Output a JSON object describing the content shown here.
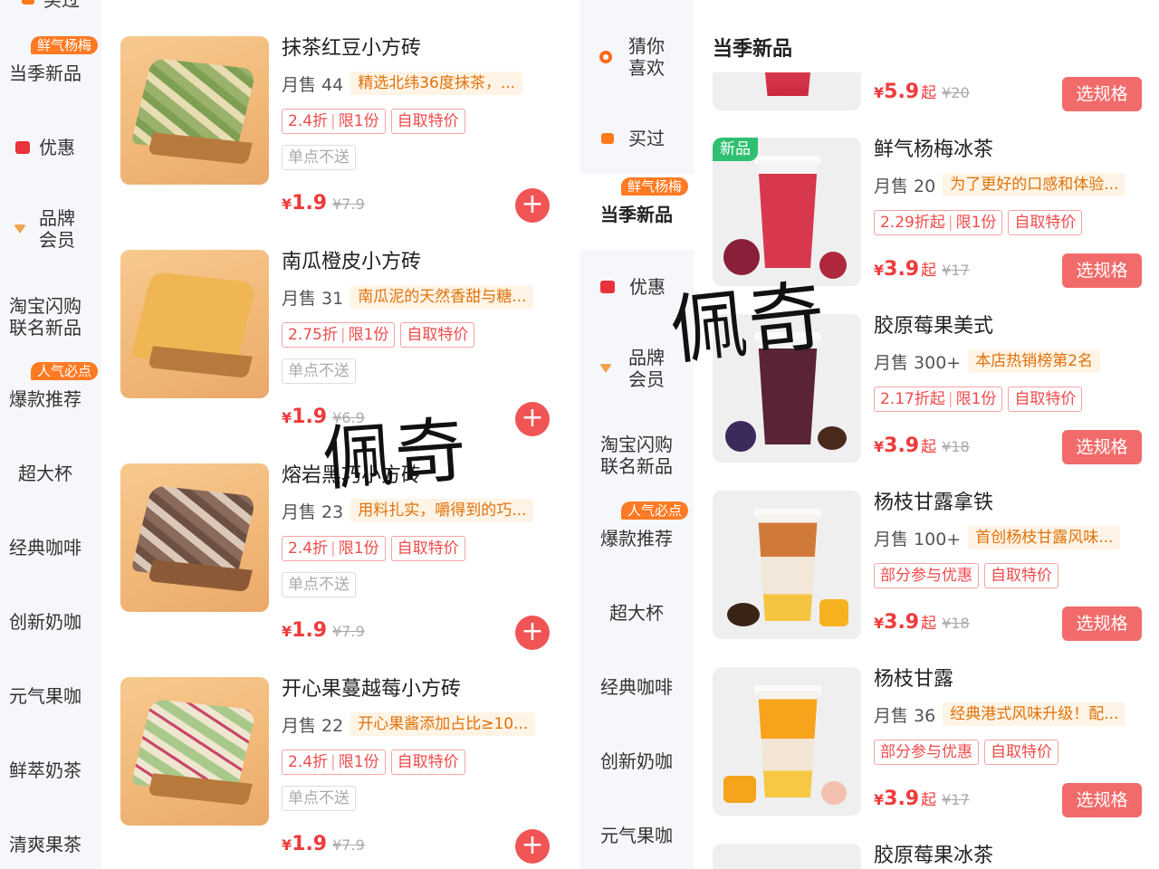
{
  "left": {
    "sidebar": {
      "top_cut": "买过",
      "items": [
        {
          "label": "当季新品",
          "badge": "鲜气杨梅"
        },
        {
          "label": "优惠"
        },
        {
          "label": "品牌会员"
        },
        {
          "label": "淘宝闪购联名新品"
        },
        {
          "label": "爆款推荐",
          "badge": "人气必点"
        },
        {
          "label": "超大杯"
        },
        {
          "label": "经典咖啡"
        },
        {
          "label": "创新奶咖"
        },
        {
          "label": "元气果咖"
        },
        {
          "label": "鲜萃奶茶"
        },
        {
          "label": "清爽果茶"
        }
      ]
    },
    "products": [
      {
        "name": "抹茶红豆小方砖",
        "sales": "月售 44",
        "desc": "精选北纬36度抹茶，...",
        "discount": "2.4折",
        "limit": "限1份",
        "pickup": "自取特价",
        "note": "单点不送",
        "price": "1.9",
        "orig": "¥7.9"
      },
      {
        "name": "南瓜橙皮小方砖",
        "sales": "月售 31",
        "desc": "南瓜泥的天然香甜与糖...",
        "discount": "2.75折",
        "limit": "限1份",
        "pickup": "自取特价",
        "note": "单点不送",
        "price": "1.9",
        "orig": "¥6.9"
      },
      {
        "name": "熔岩黑巧小方砖",
        "sales": "月售 23",
        "desc": "用料扎实，嚼得到的巧...",
        "discount": "2.4折",
        "limit": "限1份",
        "pickup": "自取特价",
        "note": "单点不送",
        "price": "1.9",
        "orig": "¥7.9"
      },
      {
        "name": "开心果蔓越莓小方砖",
        "sales": "月售 22",
        "desc": "开心果酱添加占比≥10...",
        "discount": "2.4折",
        "limit": "限1份",
        "pickup": "自取特价",
        "note": "单点不送",
        "price": "1.9",
        "orig": "¥7.9"
      }
    ],
    "add_label": "+"
  },
  "right": {
    "sidebar": {
      "items": [
        {
          "label": "猜你喜欢"
        },
        {
          "label": "买过"
        },
        {
          "label": "当季新品",
          "badge": "鲜气杨梅",
          "active": true
        },
        {
          "label": "优惠"
        },
        {
          "label": "品牌会员"
        },
        {
          "label": "淘宝闪购联名新品"
        },
        {
          "label": "爆款推荐",
          "badge": "人气必点"
        },
        {
          "label": "超大杯"
        },
        {
          "label": "经典咖啡"
        },
        {
          "label": "创新奶咖"
        },
        {
          "label": "元气果咖"
        }
      ]
    },
    "section_title": "当季新品",
    "top_price": {
      "price": "5.9",
      "unit": "起",
      "orig": "¥20"
    },
    "products": [
      {
        "name": "鲜气杨梅冰茶",
        "new_tag": "新品",
        "sales": "月售 20",
        "desc": "为了更好的口感和体验...",
        "tags": [
          "2.29折起",
          "限1份",
          "自取特价"
        ],
        "price": "3.9",
        "unit": "起",
        "orig": "¥17"
      },
      {
        "name": "胶原莓果美式",
        "sales": "月售 300+",
        "desc": "本店热销榜第2名",
        "tags": [
          "2.17折起",
          "限1份",
          "自取特价"
        ],
        "price": "3.9",
        "unit": "起",
        "orig": "¥18"
      },
      {
        "name": "杨枝甘露拿铁",
        "sales": "月售 100+",
        "desc": "首创杨枝甘露风味...",
        "tags": [
          "部分参与优惠",
          "自取特价"
        ],
        "price": "3.9",
        "unit": "起",
        "orig": "¥18"
      },
      {
        "name": "杨枝甘露",
        "sales": "月售 36",
        "desc": "经典港式风味升级！配...",
        "tags": [
          "部分参与优惠",
          "自取特价"
        ],
        "price": "3.9",
        "unit": "起",
        "orig": "¥17"
      },
      {
        "name": "胶原莓果冰茶"
      }
    ],
    "spec_label": "选规格"
  },
  "watermarks": [
    "佩奇",
    "佩奇"
  ],
  "colors": {
    "accent": "#f05454",
    "badge": "#ff7a22",
    "desc_bg": "#fff4e6",
    "new_tag": "#2fbf71"
  }
}
